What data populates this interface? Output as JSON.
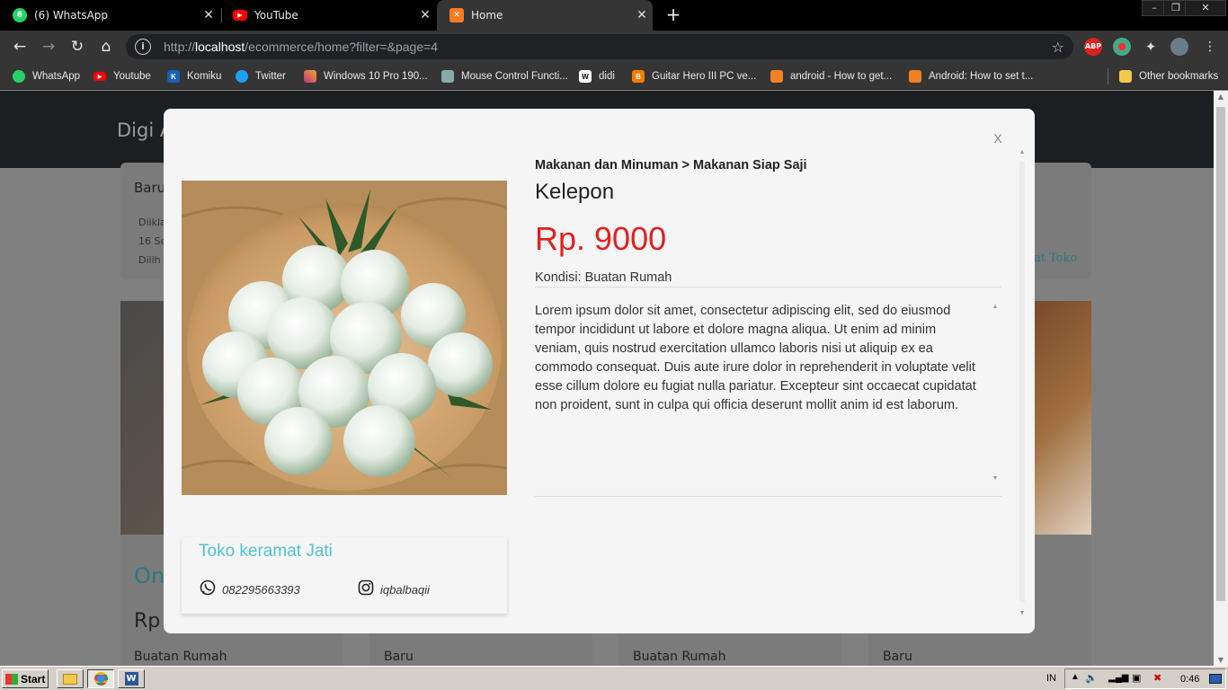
{
  "browser": {
    "tabs": [
      {
        "label": "(6) WhatsApp",
        "badge": "6",
        "icon": "whatsapp-icon",
        "color": "#25d366"
      },
      {
        "label": "YouTube",
        "icon": "youtube-icon",
        "color": "#ff0000"
      },
      {
        "label": "Home",
        "icon": "xampp-icon",
        "color": "#fb7a24"
      }
    ],
    "url_prefix": "http://",
    "url_host": "localhost",
    "url_path": "/ecommerce/home?filter=&page=4",
    "extensions": [
      {
        "name": "adblock-plus-icon",
        "label": "ABP",
        "color": "#d22"
      },
      {
        "name": "extension-globe-icon",
        "label": "",
        "color": "#4a8"
      },
      {
        "name": "puzzle-extensions-icon",
        "label": "",
        "color": "#353535"
      },
      {
        "name": "profile-avatar-icon",
        "label": "",
        "color": "#6a7c8a"
      }
    ],
    "bookmarks": [
      {
        "label": "WhatsApp",
        "icon": "whatsapp-icon",
        "color": "#25d366",
        "glyph": ""
      },
      {
        "label": "Youtube",
        "icon": "youtube-icon",
        "color": "#ff0000",
        "glyph": ""
      },
      {
        "label": "Komiku",
        "icon": "komiku-icon",
        "color": "#1a5fb4",
        "glyph": "K"
      },
      {
        "label": "Twitter",
        "icon": "twitter-icon",
        "color": "#1da1f2",
        "glyph": ""
      },
      {
        "label": "Windows 10 Pro 190...",
        "icon": "windows-icon",
        "color": "#b5338a",
        "glyph": ""
      },
      {
        "label": "Mouse Control Functi...",
        "icon": "doc-icon",
        "color": "#8aa",
        "glyph": ""
      },
      {
        "label": "didi",
        "icon": "wikipedia-icon",
        "color": "#fff",
        "glyph": "W"
      },
      {
        "label": "Guitar Hero III PC ve...",
        "icon": "blogger-icon",
        "color": "#f57d00",
        "glyph": "B"
      },
      {
        "label": "android - How to get...",
        "icon": "stackoverflow-icon",
        "color": "#f48024",
        "glyph": ""
      },
      {
        "label": "Android: How to set t...",
        "icon": "stackoverflow-icon",
        "color": "#f48024",
        "glyph": ""
      }
    ],
    "other_bookmarks": "Other bookmarks"
  },
  "site": {
    "brand": "Digi A",
    "bg_top_condition": "Baru",
    "bg_meta": [
      "Diikla",
      "16 Se",
      "Dilih"
    ],
    "bg_link": "at Toko",
    "bg_card_name": "On",
    "bg_card_price": "Rp",
    "bg_conditions": [
      "Buatan Rumah",
      "Baru",
      "Buatan Rumah",
      "Baru"
    ]
  },
  "modal": {
    "close_label": "X",
    "category": "Makanan dan Minuman > Makanan Siap Saji",
    "product_name": "Kelepon",
    "price": "Rp. 9000",
    "condition": "Kondisi: Buatan Rumah",
    "description": "Lorem ipsum dolor sit amet, consectetur adipiscing elit, sed do eiusmod tempor incididunt ut labore et dolore magna aliqua. Ut enim ad minim veniam, quis nostrud exercitation ullamco laboris nisi ut aliquip ex ea commodo consequat. Duis aute irure dolor in reprehenderit in voluptate velit esse cillum dolore eu fugiat nulla pariatur. Excepteur sint occaecat cupidatat non proident, sunt in culpa qui officia deserunt mollit anim id est laborum.",
    "shop_name": "Toko keramat Jati",
    "phone": "082295663393",
    "instagram": "iqbalbaqii"
  },
  "taskbar": {
    "start_label": "Start",
    "language": "IN",
    "clock": "0:46"
  }
}
